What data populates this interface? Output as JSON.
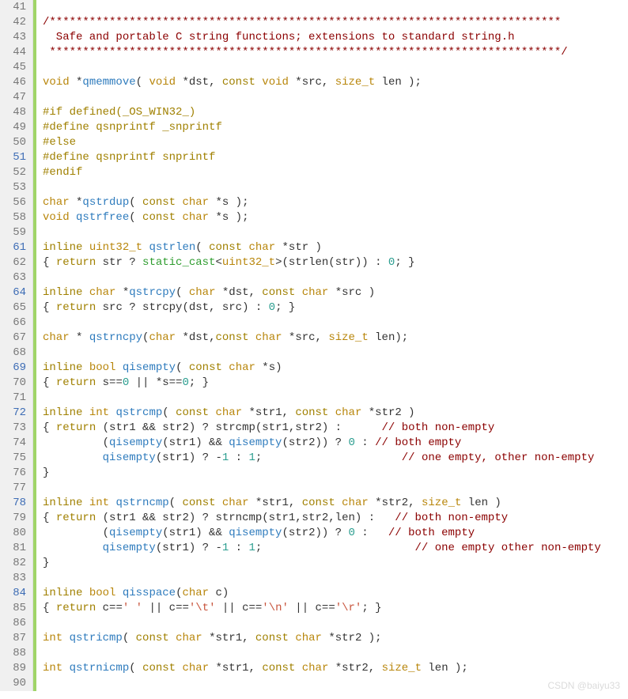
{
  "watermark": "CSDN @baiyu33",
  "lines": [
    {
      "n": 41,
      "blue": false,
      "tokens": []
    },
    {
      "n": 42,
      "blue": false,
      "tokens": [
        {
          "t": "/*****************************************************************************",
          "c": "c-comment"
        }
      ]
    },
    {
      "n": 43,
      "blue": false,
      "tokens": [
        {
          "t": "  Safe and portable C string functions; extensions to standard string.h",
          "c": "c-comment"
        }
      ]
    },
    {
      "n": 44,
      "blue": false,
      "tokens": [
        {
          "t": " *****************************************************************************/",
          "c": "c-comment"
        }
      ]
    },
    {
      "n": 45,
      "blue": false,
      "tokens": []
    },
    {
      "n": 46,
      "blue": false,
      "tokens": [
        {
          "t": "void",
          "c": "c-type"
        },
        {
          "t": " *",
          "c": "c-op"
        },
        {
          "t": "qmemmove",
          "c": "c-fn"
        },
        {
          "t": "( ",
          "c": "c-op"
        },
        {
          "t": "void",
          "c": "c-type"
        },
        {
          "t": " *dst, ",
          "c": "c-id"
        },
        {
          "t": "const",
          "c": "c-kw"
        },
        {
          "t": " ",
          "c": ""
        },
        {
          "t": "void",
          "c": "c-type"
        },
        {
          "t": " *src, ",
          "c": "c-id"
        },
        {
          "t": "size_t",
          "c": "c-type"
        },
        {
          "t": " len );",
          "c": "c-id"
        }
      ]
    },
    {
      "n": 47,
      "blue": false,
      "tokens": []
    },
    {
      "n": 48,
      "blue": false,
      "tokens": [
        {
          "t": "#if",
          "c": "c-pre"
        },
        {
          "t": " defined(_OS_WIN32_)",
          "c": "c-pre"
        }
      ]
    },
    {
      "n": 49,
      "blue": false,
      "tokens": [
        {
          "t": "#define",
          "c": "c-pre"
        },
        {
          "t": " qsnprintf _snprintf",
          "c": "c-pre"
        }
      ]
    },
    {
      "n": 50,
      "blue": false,
      "tokens": [
        {
          "t": "#else",
          "c": "c-pre"
        }
      ]
    },
    {
      "n": 51,
      "blue": true,
      "tokens": [
        {
          "t": "#define",
          "c": "c-pre"
        },
        {
          "t": " qsnprintf snprintf",
          "c": "c-pre"
        }
      ]
    },
    {
      "n": 52,
      "blue": false,
      "tokens": [
        {
          "t": "#endif",
          "c": "c-pre"
        }
      ]
    },
    {
      "n": 53,
      "blue": false,
      "tokens": []
    },
    {
      "n": 56,
      "blue": false,
      "tokens": [
        {
          "t": "char",
          "c": "c-type"
        },
        {
          "t": " *",
          "c": "c-op"
        },
        {
          "t": "qstrdup",
          "c": "c-fn"
        },
        {
          "t": "( ",
          "c": "c-op"
        },
        {
          "t": "const",
          "c": "c-kw"
        },
        {
          "t": " ",
          "c": ""
        },
        {
          "t": "char",
          "c": "c-type"
        },
        {
          "t": " *s );",
          "c": "c-id"
        }
      ]
    },
    {
      "n": 58,
      "blue": false,
      "tokens": [
        {
          "t": "void",
          "c": "c-type"
        },
        {
          "t": " ",
          "c": ""
        },
        {
          "t": "qstrfree",
          "c": "c-fn"
        },
        {
          "t": "( ",
          "c": "c-op"
        },
        {
          "t": "const",
          "c": "c-kw"
        },
        {
          "t": " ",
          "c": ""
        },
        {
          "t": "char",
          "c": "c-type"
        },
        {
          "t": " *s );",
          "c": "c-id"
        }
      ]
    },
    {
      "n": 59,
      "blue": false,
      "tokens": []
    },
    {
      "n": 61,
      "blue": true,
      "tokens": [
        {
          "t": "inline",
          "c": "c-kw"
        },
        {
          "t": " ",
          "c": ""
        },
        {
          "t": "uint32_t",
          "c": "c-type"
        },
        {
          "t": " ",
          "c": ""
        },
        {
          "t": "qstrlen",
          "c": "c-fn"
        },
        {
          "t": "( ",
          "c": "c-op"
        },
        {
          "t": "const",
          "c": "c-kw"
        },
        {
          "t": " ",
          "c": ""
        },
        {
          "t": "char",
          "c": "c-type"
        },
        {
          "t": " *str )",
          "c": "c-id"
        }
      ]
    },
    {
      "n": 62,
      "blue": false,
      "tokens": [
        {
          "t": "{ ",
          "c": "c-op"
        },
        {
          "t": "return",
          "c": "c-kw"
        },
        {
          "t": " str ? ",
          "c": "c-id"
        },
        {
          "t": "static_cast",
          "c": "c-tpl"
        },
        {
          "t": "<",
          "c": "c-op"
        },
        {
          "t": "uint32_t",
          "c": "c-type"
        },
        {
          "t": ">(strlen(str)) : ",
          "c": "c-id"
        },
        {
          "t": "0",
          "c": "c-num"
        },
        {
          "t": "; }",
          "c": "c-op"
        }
      ]
    },
    {
      "n": 63,
      "blue": false,
      "tokens": []
    },
    {
      "n": 64,
      "blue": true,
      "tokens": [
        {
          "t": "inline",
          "c": "c-kw"
        },
        {
          "t": " ",
          "c": ""
        },
        {
          "t": "char",
          "c": "c-type"
        },
        {
          "t": " *",
          "c": "c-op"
        },
        {
          "t": "qstrcpy",
          "c": "c-fn"
        },
        {
          "t": "( ",
          "c": "c-op"
        },
        {
          "t": "char",
          "c": "c-type"
        },
        {
          "t": " *dst, ",
          "c": "c-id"
        },
        {
          "t": "const",
          "c": "c-kw"
        },
        {
          "t": " ",
          "c": ""
        },
        {
          "t": "char",
          "c": "c-type"
        },
        {
          "t": " *src )",
          "c": "c-id"
        }
      ]
    },
    {
      "n": 65,
      "blue": false,
      "tokens": [
        {
          "t": "{ ",
          "c": "c-op"
        },
        {
          "t": "return",
          "c": "c-kw"
        },
        {
          "t": " src ? strcpy(dst, src) : ",
          "c": "c-id"
        },
        {
          "t": "0",
          "c": "c-num"
        },
        {
          "t": "; }",
          "c": "c-op"
        }
      ]
    },
    {
      "n": 66,
      "blue": false,
      "tokens": []
    },
    {
      "n": 67,
      "blue": false,
      "tokens": [
        {
          "t": "char",
          "c": "c-type"
        },
        {
          "t": " * ",
          "c": "c-op"
        },
        {
          "t": "qstrncpy",
          "c": "c-fn"
        },
        {
          "t": "(",
          "c": "c-op"
        },
        {
          "t": "char",
          "c": "c-type"
        },
        {
          "t": " *dst,",
          "c": "c-id"
        },
        {
          "t": "const",
          "c": "c-kw"
        },
        {
          "t": " ",
          "c": ""
        },
        {
          "t": "char",
          "c": "c-type"
        },
        {
          "t": " *src, ",
          "c": "c-id"
        },
        {
          "t": "size_t",
          "c": "c-type"
        },
        {
          "t": " len);",
          "c": "c-id"
        }
      ]
    },
    {
      "n": 68,
      "blue": false,
      "tokens": []
    },
    {
      "n": 69,
      "blue": true,
      "tokens": [
        {
          "t": "inline",
          "c": "c-kw"
        },
        {
          "t": " ",
          "c": ""
        },
        {
          "t": "bool",
          "c": "c-type"
        },
        {
          "t": " ",
          "c": ""
        },
        {
          "t": "qisempty",
          "c": "c-fn"
        },
        {
          "t": "( ",
          "c": "c-op"
        },
        {
          "t": "const",
          "c": "c-kw"
        },
        {
          "t": " ",
          "c": ""
        },
        {
          "t": "char",
          "c": "c-type"
        },
        {
          "t": " *s)",
          "c": "c-id"
        }
      ]
    },
    {
      "n": 70,
      "blue": false,
      "tokens": [
        {
          "t": "{ ",
          "c": "c-op"
        },
        {
          "t": "return",
          "c": "c-kw"
        },
        {
          "t": " s==",
          "c": "c-id"
        },
        {
          "t": "0",
          "c": "c-num"
        },
        {
          "t": " || *s==",
          "c": "c-id"
        },
        {
          "t": "0",
          "c": "c-num"
        },
        {
          "t": "; }",
          "c": "c-op"
        }
      ]
    },
    {
      "n": 71,
      "blue": false,
      "tokens": []
    },
    {
      "n": 72,
      "blue": true,
      "tokens": [
        {
          "t": "inline",
          "c": "c-kw"
        },
        {
          "t": " ",
          "c": ""
        },
        {
          "t": "int",
          "c": "c-type"
        },
        {
          "t": " ",
          "c": ""
        },
        {
          "t": "qstrcmp",
          "c": "c-fn"
        },
        {
          "t": "( ",
          "c": "c-op"
        },
        {
          "t": "const",
          "c": "c-kw"
        },
        {
          "t": " ",
          "c": ""
        },
        {
          "t": "char",
          "c": "c-type"
        },
        {
          "t": " *str1, ",
          "c": "c-id"
        },
        {
          "t": "const",
          "c": "c-kw"
        },
        {
          "t": " ",
          "c": ""
        },
        {
          "t": "char",
          "c": "c-type"
        },
        {
          "t": " *str2 )",
          "c": "c-id"
        }
      ]
    },
    {
      "n": 73,
      "blue": false,
      "tokens": [
        {
          "t": "{ ",
          "c": "c-op"
        },
        {
          "t": "return",
          "c": "c-kw"
        },
        {
          "t": " (str1 && str2) ? strcmp(str1,str2) :      ",
          "c": "c-id"
        },
        {
          "t": "// both non-empty",
          "c": "c-comment"
        }
      ]
    },
    {
      "n": 74,
      "blue": false,
      "tokens": [
        {
          "t": "         (",
          "c": "c-op"
        },
        {
          "t": "qisempty",
          "c": "c-fn"
        },
        {
          "t": "(str1) && ",
          "c": "c-id"
        },
        {
          "t": "qisempty",
          "c": "c-fn"
        },
        {
          "t": "(str2)) ? ",
          "c": "c-id"
        },
        {
          "t": "0",
          "c": "c-num"
        },
        {
          "t": " : ",
          "c": "c-id"
        },
        {
          "t": "// both empty",
          "c": "c-comment"
        }
      ]
    },
    {
      "n": 75,
      "blue": false,
      "tokens": [
        {
          "t": "         ",
          "c": ""
        },
        {
          "t": "qisempty",
          "c": "c-fn"
        },
        {
          "t": "(str1) ? -",
          "c": "c-id"
        },
        {
          "t": "1",
          "c": "c-num"
        },
        {
          "t": " : ",
          "c": "c-id"
        },
        {
          "t": "1",
          "c": "c-num"
        },
        {
          "t": ";                     ",
          "c": "c-id"
        },
        {
          "t": "// one empty, other non-empty",
          "c": "c-comment"
        }
      ]
    },
    {
      "n": 76,
      "blue": false,
      "tokens": [
        {
          "t": "}",
          "c": "c-op"
        }
      ]
    },
    {
      "n": 77,
      "blue": false,
      "tokens": []
    },
    {
      "n": 78,
      "blue": true,
      "tokens": [
        {
          "t": "inline",
          "c": "c-kw"
        },
        {
          "t": " ",
          "c": ""
        },
        {
          "t": "int",
          "c": "c-type"
        },
        {
          "t": " ",
          "c": ""
        },
        {
          "t": "qstrncmp",
          "c": "c-fn"
        },
        {
          "t": "( ",
          "c": "c-op"
        },
        {
          "t": "const",
          "c": "c-kw"
        },
        {
          "t": " ",
          "c": ""
        },
        {
          "t": "char",
          "c": "c-type"
        },
        {
          "t": " *str1, ",
          "c": "c-id"
        },
        {
          "t": "const",
          "c": "c-kw"
        },
        {
          "t": " ",
          "c": ""
        },
        {
          "t": "char",
          "c": "c-type"
        },
        {
          "t": " *str2, ",
          "c": "c-id"
        },
        {
          "t": "size_t",
          "c": "c-type"
        },
        {
          "t": " len )",
          "c": "c-id"
        }
      ]
    },
    {
      "n": 79,
      "blue": false,
      "tokens": [
        {
          "t": "{ ",
          "c": "c-op"
        },
        {
          "t": "return",
          "c": "c-kw"
        },
        {
          "t": " (str1 && str2) ? strncmp(str1,str2,len) :   ",
          "c": "c-id"
        },
        {
          "t": "// both non-empty",
          "c": "c-comment"
        }
      ]
    },
    {
      "n": 80,
      "blue": false,
      "tokens": [
        {
          "t": "         (",
          "c": "c-op"
        },
        {
          "t": "qisempty",
          "c": "c-fn"
        },
        {
          "t": "(str1) && ",
          "c": "c-id"
        },
        {
          "t": "qisempty",
          "c": "c-fn"
        },
        {
          "t": "(str2)) ? ",
          "c": "c-id"
        },
        {
          "t": "0",
          "c": "c-num"
        },
        {
          "t": " :   ",
          "c": "c-id"
        },
        {
          "t": "// both empty",
          "c": "c-comment"
        }
      ]
    },
    {
      "n": 81,
      "blue": false,
      "tokens": [
        {
          "t": "         ",
          "c": ""
        },
        {
          "t": "qisempty",
          "c": "c-fn"
        },
        {
          "t": "(str1) ? -",
          "c": "c-id"
        },
        {
          "t": "1",
          "c": "c-num"
        },
        {
          "t": " : ",
          "c": "c-id"
        },
        {
          "t": "1",
          "c": "c-num"
        },
        {
          "t": ";                       ",
          "c": "c-id"
        },
        {
          "t": "// one empty other non-empty",
          "c": "c-comment"
        }
      ]
    },
    {
      "n": 82,
      "blue": false,
      "tokens": [
        {
          "t": "}",
          "c": "c-op"
        }
      ]
    },
    {
      "n": 83,
      "blue": false,
      "tokens": []
    },
    {
      "n": 84,
      "blue": true,
      "tokens": [
        {
          "t": "inline",
          "c": "c-kw"
        },
        {
          "t": " ",
          "c": ""
        },
        {
          "t": "bool",
          "c": "c-type"
        },
        {
          "t": " ",
          "c": ""
        },
        {
          "t": "qisspace",
          "c": "c-fn"
        },
        {
          "t": "(",
          "c": "c-op"
        },
        {
          "t": "char",
          "c": "c-type"
        },
        {
          "t": " c)",
          "c": "c-id"
        }
      ]
    },
    {
      "n": 85,
      "blue": false,
      "tokens": [
        {
          "t": "{ ",
          "c": "c-op"
        },
        {
          "t": "return",
          "c": "c-kw"
        },
        {
          "t": " c==",
          "c": "c-id"
        },
        {
          "t": "' '",
          "c": "c-str"
        },
        {
          "t": " || c==",
          "c": "c-id"
        },
        {
          "t": "'\\t'",
          "c": "c-str"
        },
        {
          "t": " || c==",
          "c": "c-id"
        },
        {
          "t": "'\\n'",
          "c": "c-str"
        },
        {
          "t": " || c==",
          "c": "c-id"
        },
        {
          "t": "'\\r'",
          "c": "c-str"
        },
        {
          "t": "; }",
          "c": "c-op"
        }
      ]
    },
    {
      "n": 86,
      "blue": false,
      "tokens": []
    },
    {
      "n": 87,
      "blue": false,
      "tokens": [
        {
          "t": "int",
          "c": "c-type"
        },
        {
          "t": " ",
          "c": ""
        },
        {
          "t": "qstricmp",
          "c": "c-fn"
        },
        {
          "t": "( ",
          "c": "c-op"
        },
        {
          "t": "const",
          "c": "c-kw"
        },
        {
          "t": " ",
          "c": ""
        },
        {
          "t": "char",
          "c": "c-type"
        },
        {
          "t": " *str1, ",
          "c": "c-id"
        },
        {
          "t": "const",
          "c": "c-kw"
        },
        {
          "t": " ",
          "c": ""
        },
        {
          "t": "char",
          "c": "c-type"
        },
        {
          "t": " *str2 );",
          "c": "c-id"
        }
      ]
    },
    {
      "n": 88,
      "blue": false,
      "tokens": []
    },
    {
      "n": 89,
      "blue": false,
      "tokens": [
        {
          "t": "int",
          "c": "c-type"
        },
        {
          "t": " ",
          "c": ""
        },
        {
          "t": "qstrnicmp",
          "c": "c-fn"
        },
        {
          "t": "( ",
          "c": "c-op"
        },
        {
          "t": "const",
          "c": "c-kw"
        },
        {
          "t": " ",
          "c": ""
        },
        {
          "t": "char",
          "c": "c-type"
        },
        {
          "t": " *str1, ",
          "c": "c-id"
        },
        {
          "t": "const",
          "c": "c-kw"
        },
        {
          "t": " ",
          "c": ""
        },
        {
          "t": "char",
          "c": "c-type"
        },
        {
          "t": " *str2, ",
          "c": "c-id"
        },
        {
          "t": "size_t",
          "c": "c-type"
        },
        {
          "t": " len );",
          "c": "c-id"
        }
      ]
    },
    {
      "n": 90,
      "blue": false,
      "tokens": []
    }
  ]
}
